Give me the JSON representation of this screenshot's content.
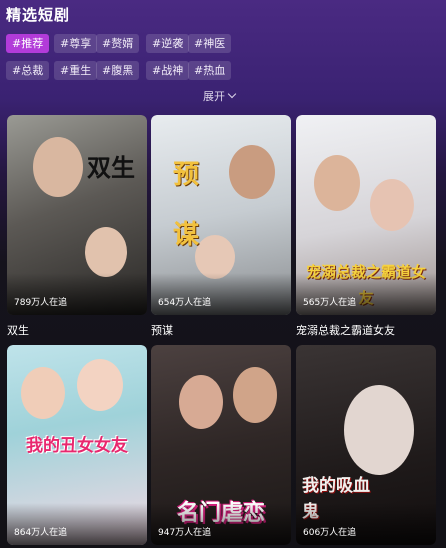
{
  "header": {
    "title": "精选短剧"
  },
  "tags": [
    "#推荐",
    "#尊享",
    "#赘婿",
    "#逆袭",
    "#神医",
    "#总裁",
    "#重生",
    "#腹黑",
    "#战神",
    "#热血"
  ],
  "expand_label": "展开",
  "dramas": [
    {
      "title": "双生",
      "viewers": "789万人在追",
      "poster_text": "双生"
    },
    {
      "title": "预谋",
      "viewers": "654万人在追",
      "poster_text": "预谋"
    },
    {
      "title": "宠溺总裁之霸道女友",
      "viewers": "565万人在追",
      "poster_text": "宠溺总裁之霸道女友"
    },
    {
      "title": "",
      "viewers": "864万人在追",
      "poster_text": "我的丑女女友"
    },
    {
      "title": "",
      "viewers": "947万人在追",
      "poster_text": "名门虐恋"
    },
    {
      "title": "",
      "viewers": "606万人在追",
      "poster_text": "我的吸血鬼"
    }
  ]
}
